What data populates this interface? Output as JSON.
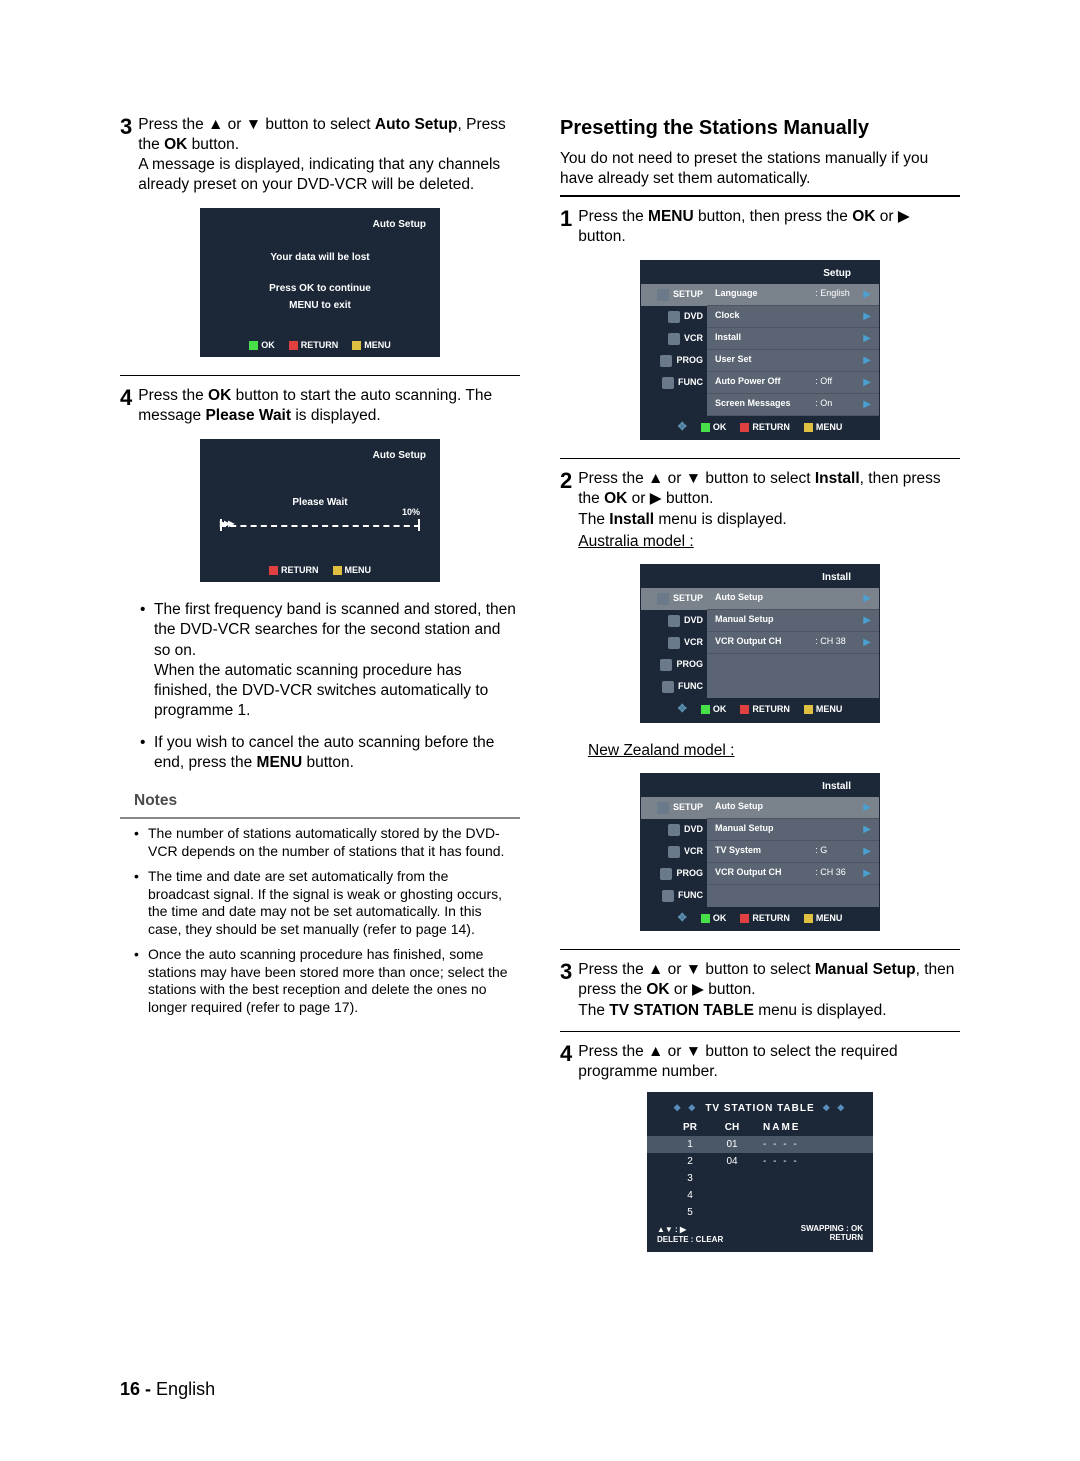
{
  "left": {
    "step3": {
      "pre": "Press the ",
      "mid1": " or ",
      "mid2": " button to select ",
      "auto_setup": "Auto Setup",
      "press_the": ", Press the ",
      "ok": "OK",
      "button_period": " button.",
      "line2": "A message is displayed, indicating that any channels already preset on your DVD-VCR will be deleted."
    },
    "osd1": {
      "title": "Auto Setup",
      "l1": "Your data will be lost",
      "l2a": "Press ",
      "l2b": "OK",
      "l2c": " to continue",
      "l3a": "MENU",
      "l3b": " to exit"
    },
    "footer": {
      "ok": "OK",
      "return": "RETURN",
      "menu": "MENU"
    },
    "step4": {
      "pre": "Press the ",
      "ok": "OK",
      "mid": " button to start the auto scanning. The message ",
      "pw": "Please Wait",
      "end": " is displayed."
    },
    "osd2": {
      "title": "Auto Setup",
      "center": "Please Wait",
      "pct": "10%"
    },
    "bul1": "The first frequency band is scanned and stored, then the DVD-VCR searches for the second station and so on.\nWhen the automatic scanning procedure has finished, the DVD-VCR switches automatically to programme 1.",
    "bul2_pre": "If you wish to cancel the auto scanning before the end, press the ",
    "bul2_bold": "MENU",
    "bul2_end": " button.",
    "notes_h": "Notes",
    "notes": [
      "The number of stations automatically stored by the DVD-VCR depends on the number of stations that it has found.",
      "The time and date are set automatically from the broadcast signal. If the signal is weak or ghosting occurs, the time and date may not be set automatically. In this case, they should be set manually (refer to page 14).",
      "Once the auto scanning procedure has finished, some stations may have been stored more than once; select the stations with the best reception and delete the ones no longer required (refer to page 17)."
    ]
  },
  "right": {
    "heading": "Presetting the Stations Manually",
    "intro": "You do not need to preset the stations manually if you have already set them automatically.",
    "step1": {
      "pre": "Press the ",
      "menu": "MENU",
      "mid": " button, then press the ",
      "ok": "OK",
      "or": " or ",
      "end": " button."
    },
    "setup_osd": {
      "title": "Setup",
      "tabs": [
        "SETUP",
        "DVD",
        "VCR",
        "PROG",
        "FUNC"
      ],
      "rows": [
        {
          "label": "Language",
          "val": ": English"
        },
        {
          "label": "Clock",
          "val": ""
        },
        {
          "label": "Install",
          "val": ""
        },
        {
          "label": "User Set",
          "val": ""
        },
        {
          "label": "Auto Power Off",
          "val": ": Off"
        },
        {
          "label": "Screen Messages",
          "val": ": On"
        }
      ]
    },
    "step2": {
      "pre": "Press the ",
      "mid1": " or ",
      "mid2": " button to select ",
      "install": "Install",
      "then": ", then press the ",
      "ok": "OK",
      "or": " or ",
      "end": " button.",
      "line2a": "The ",
      "line2b": "Install",
      "line2c": " menu is displayed.",
      "aus": "Australia model :",
      "nz": "New Zealand model :"
    },
    "install_aus": {
      "title": "Install",
      "rows": [
        {
          "label": "Auto Setup",
          "val": ""
        },
        {
          "label": "Manual Setup",
          "val": ""
        },
        {
          "label": "VCR Output  CH",
          "val": ": CH 38"
        }
      ]
    },
    "install_nz": {
      "title": "Install",
      "rows": [
        {
          "label": "Auto Setup",
          "val": ""
        },
        {
          "label": "Manual Setup",
          "val": ""
        },
        {
          "label": "TV System",
          "val": ": G"
        },
        {
          "label": "VCR Output  CH",
          "val": ": CH 36"
        }
      ]
    },
    "step3": {
      "pre": "Press the ",
      "mid1": " or ",
      "mid2": " button to select ",
      "ms": "Manual Setup",
      "then": ", then press the ",
      "ok": "OK",
      "or": " or ",
      "end": " button.",
      "l2a": "The ",
      "l2b": "TV STATION TABLE",
      "l2c": " menu is displayed."
    },
    "step4": {
      "pre": "Press the ",
      "mid1": " or ",
      "end": " button to select the required programme number."
    },
    "stn": {
      "title": "TV STATION TABLE",
      "head": {
        "pr": "PR",
        "ch": "CH",
        "name": "NAME"
      },
      "rows": [
        {
          "pr": "1",
          "ch": "01",
          "name": "- - - -"
        },
        {
          "pr": "2",
          "ch": "04",
          "name": "- - - -"
        },
        {
          "pr": "3",
          "ch": "",
          "name": ""
        },
        {
          "pr": "4",
          "ch": "",
          "name": ""
        },
        {
          "pr": "5",
          "ch": "",
          "name": ""
        }
      ],
      "foot_l": "▲▼ : ▶\nDELETE : CLEAR",
      "foot_r": "SWAPPING : OK\nRETURN"
    }
  },
  "footer": {
    "page": "16 -",
    "lang": "English"
  },
  "glyph": {
    "up": "▲",
    "down": "▼",
    "right": "▶",
    "deco": "❖ ❖"
  }
}
